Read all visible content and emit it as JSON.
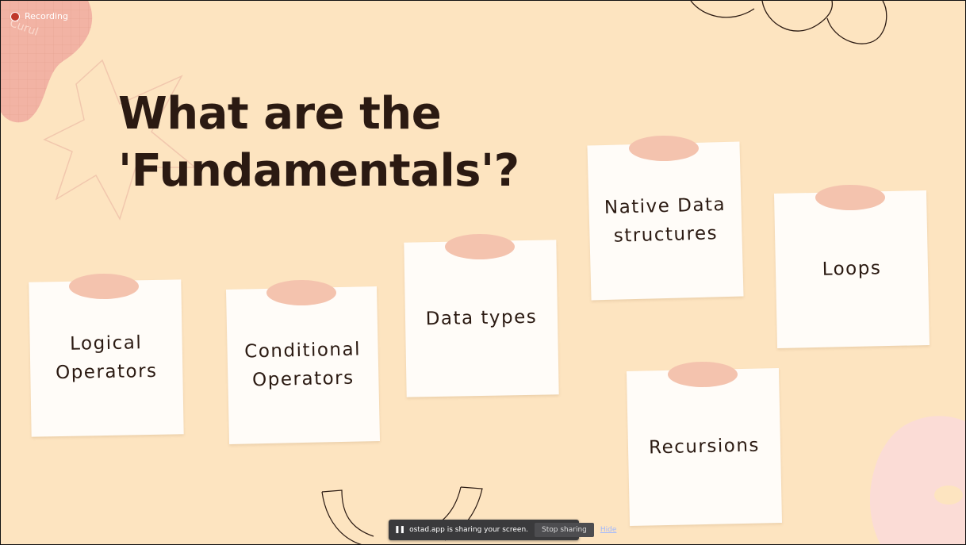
{
  "recording": {
    "label": "Recording"
  },
  "slide": {
    "title_line1": "What are the",
    "title_line2": "'Fundamentals'?",
    "notes": [
      {
        "label": "Logical\nOperators"
      },
      {
        "label": "Conditional\nOperators"
      },
      {
        "label": "Data types"
      },
      {
        "label": "Native Data\nstructures"
      },
      {
        "label": "Loops"
      },
      {
        "label": "Recursions"
      }
    ]
  },
  "share_bar": {
    "pause_icon": "pause-icon",
    "message": "ostad.app is sharing your screen.",
    "stop_label": "Stop sharing",
    "hide_label": "Hide"
  },
  "colors": {
    "background": "#fde4c0",
    "title": "#2b1a12",
    "note": "#fffcf8",
    "tape": "#f4c3ae"
  }
}
